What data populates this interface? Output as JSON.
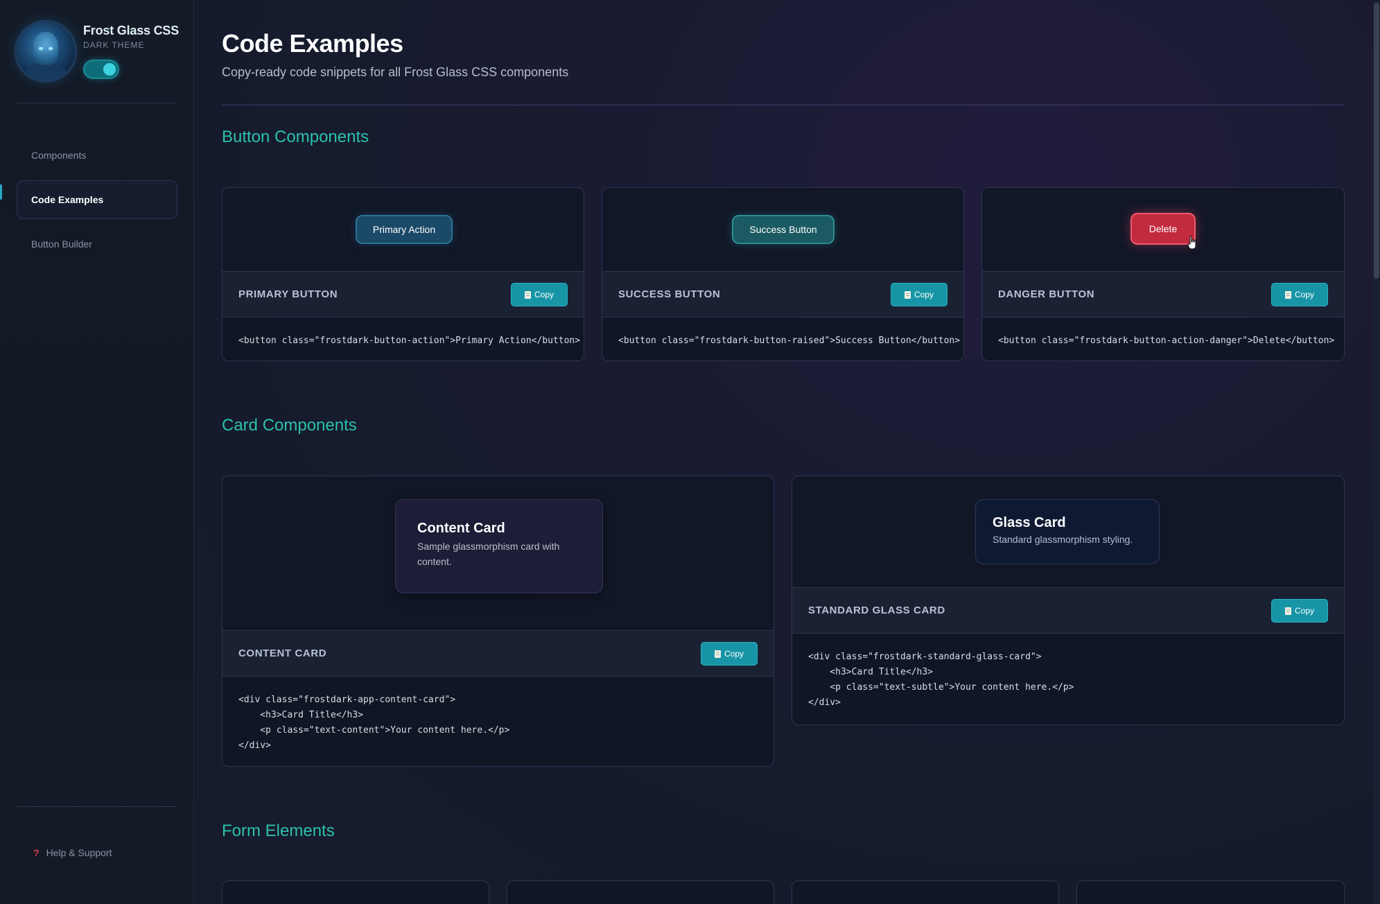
{
  "brand": {
    "title": "Frost Glass CSS",
    "subtitle": "DARK THEME",
    "theme_toggle_on": true
  },
  "nav": {
    "items": [
      {
        "label": "Components",
        "active": false
      },
      {
        "label": "Code Examples",
        "active": true
      },
      {
        "label": "Button Builder",
        "active": false
      }
    ],
    "help_icon": "question-mark-icon",
    "help_label": "Help & Support"
  },
  "page": {
    "title": "Code Examples",
    "subtitle": "Copy-ready code snippets for all Frost Glass CSS components"
  },
  "sections": {
    "buttons": "Button Components",
    "cards": "Card Components",
    "forms": "Form Elements"
  },
  "copy_label": "Copy",
  "copy_icon": "clipboard-icon",
  "button_examples": [
    {
      "demo_label": "Primary Action",
      "title": "PRIMARY BUTTON",
      "code": "<button class=\"frostdark-button-action\">Primary Action</button>"
    },
    {
      "demo_label": "Success Button",
      "title": "SUCCESS BUTTON",
      "code": "<button class=\"frostdark-button-raised\">Success Button</button>"
    },
    {
      "demo_label": "Delete",
      "title": "DANGER BUTTON",
      "code": "<button class=\"frostdark-button-action-danger\">Delete</button>"
    }
  ],
  "card_examples": [
    {
      "demo_title": "Content Card",
      "demo_text": "Sample glassmorphism card with content.",
      "title": "CONTENT CARD",
      "code": "<div class=\"frostdark-app-content-card\">\n    <h3>Card Title</h3>\n    <p class=\"text-content\">Your content here.</p>\n</div>"
    },
    {
      "demo_title": "Glass Card",
      "demo_text": "Standard glassmorphism styling.",
      "title": "STANDARD GLASS CARD",
      "code": "<div class=\"frostdark-standard-glass-card\">\n    <h3>Card Title</h3>\n    <p class=\"text-subtle\">Your content here.</p>\n</div>"
    }
  ],
  "colors": {
    "accent": "#2cc0b0",
    "copy_button": "#1795a6",
    "danger": "#c22a3e",
    "background": "#151b2c"
  }
}
